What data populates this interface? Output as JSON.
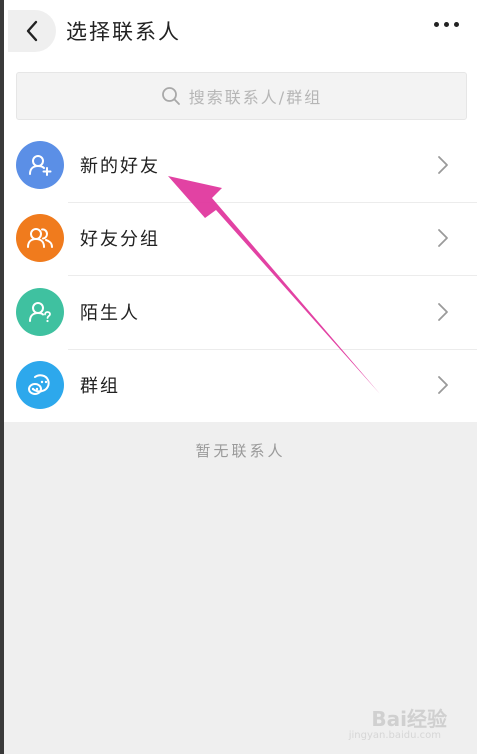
{
  "header": {
    "title": "选择联系人",
    "back_icon": "chevron-left-icon",
    "more_icon": "more-dots-icon"
  },
  "search": {
    "placeholder": "搜索联系人/群组",
    "icon": "search-icon"
  },
  "list": {
    "items": [
      {
        "label": "新的好友",
        "icon": "add-friend-icon",
        "color": "#5b8fe6"
      },
      {
        "label": "好友分组",
        "icon": "friend-group-icon",
        "color": "#f07b1d"
      },
      {
        "label": "陌生人",
        "icon": "stranger-icon",
        "color": "#3fc1a0"
      },
      {
        "label": "群组",
        "icon": "group-chat-icon",
        "color": "#2da8ec"
      }
    ]
  },
  "empty_state": "暂无联系人",
  "annotation_arrow_color": "#e0389e",
  "watermark": {
    "text": "Bai经验",
    "sub": "jingyan.baidu.com"
  }
}
